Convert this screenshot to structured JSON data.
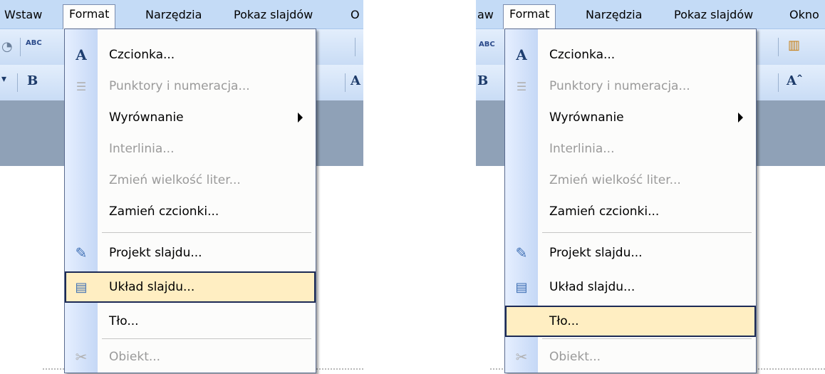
{
  "left": {
    "menubar": [
      "Wstaw",
      "Format",
      "Narzędzia",
      "Pokaz slajdów",
      "O"
    ],
    "highlighted_item": "Układ slajdu..."
  },
  "right": {
    "menubar": [
      "aw",
      "Format",
      "Narzędzia",
      "Pokaz slajdów",
      "Okno"
    ],
    "highlighted_item": "Tło..."
  },
  "menu_items": [
    {
      "label": "Czcionka...",
      "icon": "font-a-icon",
      "enabled": true
    },
    {
      "label": "Punktory i numeracja...",
      "icon": "bullets-icon",
      "enabled": false
    },
    {
      "label": "Wyrównanie",
      "icon": "",
      "enabled": true,
      "submenu": true
    },
    {
      "label": "Interlinia...",
      "icon": "",
      "enabled": false
    },
    {
      "label": "Zmień wielkość liter...",
      "icon": "",
      "enabled": false
    },
    {
      "label": "Zamień czcionki...",
      "icon": "",
      "enabled": true
    },
    {
      "label": "Projekt slajdu...",
      "icon": "design-pencil-icon",
      "enabled": true
    },
    {
      "label": "Układ slajdu...",
      "icon": "slide-layout-icon",
      "enabled": true
    },
    {
      "label": "Tło...",
      "icon": "",
      "enabled": true
    },
    {
      "label": "Obiekt...",
      "icon": "object-icon",
      "enabled": false
    }
  ],
  "toolbar": {
    "bold": "B",
    "abc": "ABC",
    "font_a": "A",
    "font_grow": "Aˆ"
  },
  "colors": {
    "menubar": "#c4dbf6",
    "highlight": "#ffeec2",
    "highlight_border": "#1c2a55",
    "dark_bar": "#8fa1b7"
  }
}
